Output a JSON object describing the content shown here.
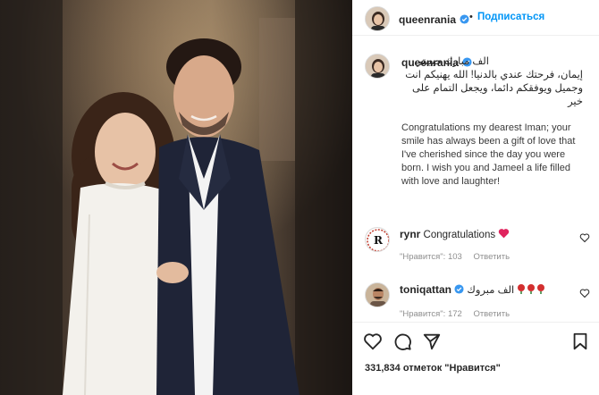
{
  "post": {
    "username": "queenrania",
    "follow_label": "Подписаться",
    "dot": "•",
    "caption_arabic": "الف مبارك حبيبتي إيمان، فرحتك عندي بالدنيا! الله يهنيكم انت وجميل ويوفقكم دائما، ويجعل التمام على خير",
    "caption_english": "Congratulations my dearest Iman; your smile has always been a gift of love that I've cherished since the day you were born. I wish you and Jameel a life filled with love and laughter!"
  },
  "comments": [
    {
      "username": "rynr",
      "text": "Congratulations",
      "likes_label": "\"Нравится\": 103",
      "reply_label": "Ответить",
      "emoji": "red-heart"
    },
    {
      "username": "toniqattan",
      "text": "الف مبروك",
      "likes_label": "\"Нравится\": 172",
      "reply_label": "Ответить",
      "emoji": "roses"
    }
  ],
  "actions": {
    "likes_text": "331,834 отметок \"Нравится\""
  },
  "colors": {
    "accent": "#0095f6",
    "heart": "#ed4956",
    "muted": "#8e8e8e"
  },
  "icons": [
    "verified-badge-icon",
    "heart-icon",
    "comment-icon",
    "share-icon",
    "bookmark-icon",
    "red-heart-icon",
    "rose-icon"
  ]
}
